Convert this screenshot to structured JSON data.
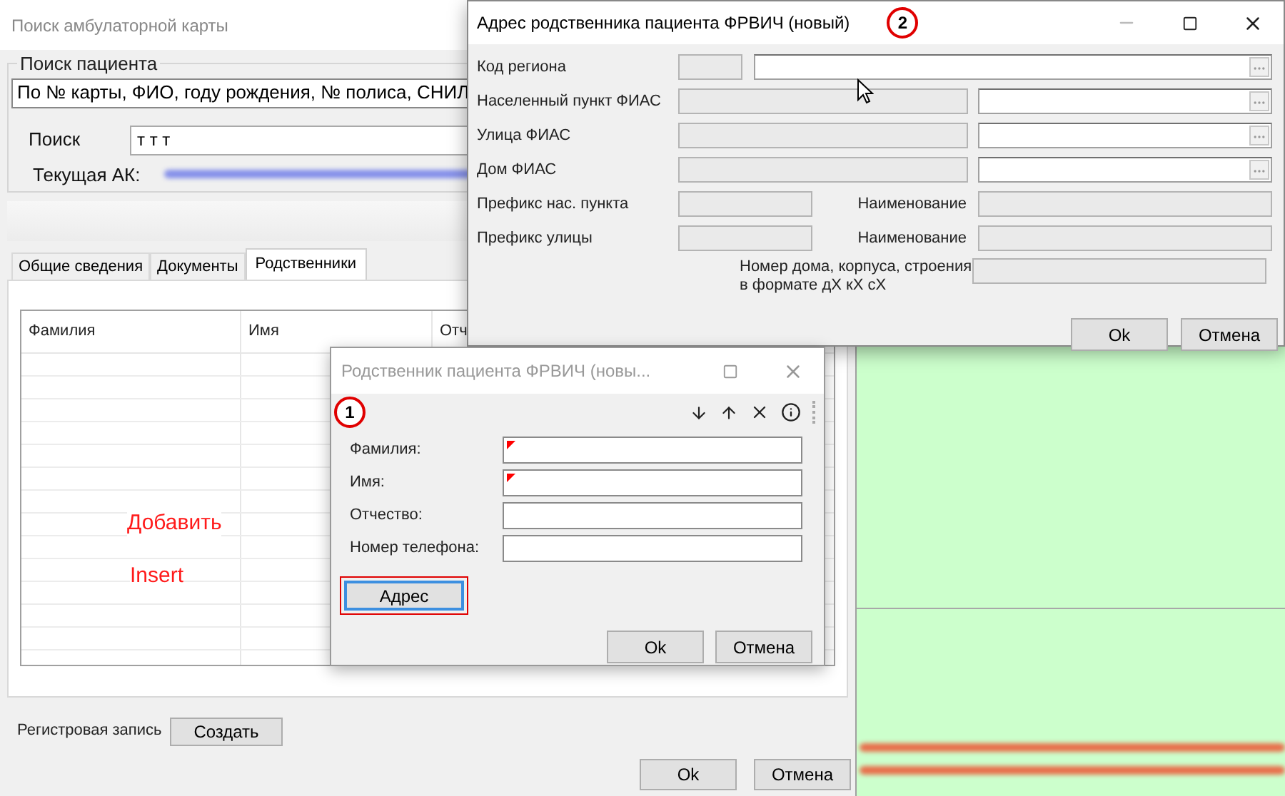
{
  "main_window": {
    "title": "Поиск амбулаторной карты",
    "search_group": {
      "title": "Поиск пациента",
      "mode": "По № карты, ФИО, году рождения, № полиса, СНИЛ",
      "search_label": "Поиск",
      "search_value": "т т т",
      "current_card_label": "Текущая АК:"
    },
    "tabs": [
      {
        "label": "Общие сведения",
        "selected": false
      },
      {
        "label": "Документы",
        "selected": false
      },
      {
        "label": "Родственники",
        "selected": true
      }
    ],
    "grid": {
      "columns": [
        "Фамилия",
        "Имя",
        "Отч"
      ]
    },
    "hints": [
      "Добавить",
      "Insert"
    ],
    "register_label": "Регистровая запись",
    "create_button": "Создать",
    "buttons": [
      "Ok",
      "Отмена"
    ]
  },
  "address_dialog": {
    "title": "Адрес родственника пациента ФРВИЧ (новый)",
    "active": true,
    "step": "2",
    "rows": [
      {
        "kind": "code",
        "label": "Код региона"
      },
      {
        "kind": "fias",
        "label": "Населенный пункт ФИАС"
      },
      {
        "kind": "fias",
        "label": "Улица ФИАС"
      },
      {
        "kind": "fias",
        "label": "Дом ФИАС"
      },
      {
        "kind": "prefix",
        "label": "Префикс нас. пункта",
        "name_label": "Наименование"
      },
      {
        "kind": "prefix",
        "label": "Префикс улицы",
        "name_label": "Наименование"
      },
      {
        "kind": "house",
        "label": "Номер дома, корпуса, строения в формате дХ кХ сХ"
      }
    ],
    "buttons": [
      "Ok",
      "Отмена"
    ]
  },
  "relative_dialog": {
    "title": "Родственник пациента ФРВИЧ (новы...",
    "active": false,
    "step": "1",
    "fields": [
      {
        "label": "Фамилия:",
        "required": true
      },
      {
        "label": "Имя:",
        "required": true
      },
      {
        "label": "Отчество:",
        "required": false
      },
      {
        "label": "Номер телефона:",
        "required": false
      }
    ],
    "address_button": {
      "label": "Адрес",
      "highlighted": true
    },
    "buttons": [
      "Ok",
      "Отмена"
    ]
  }
}
